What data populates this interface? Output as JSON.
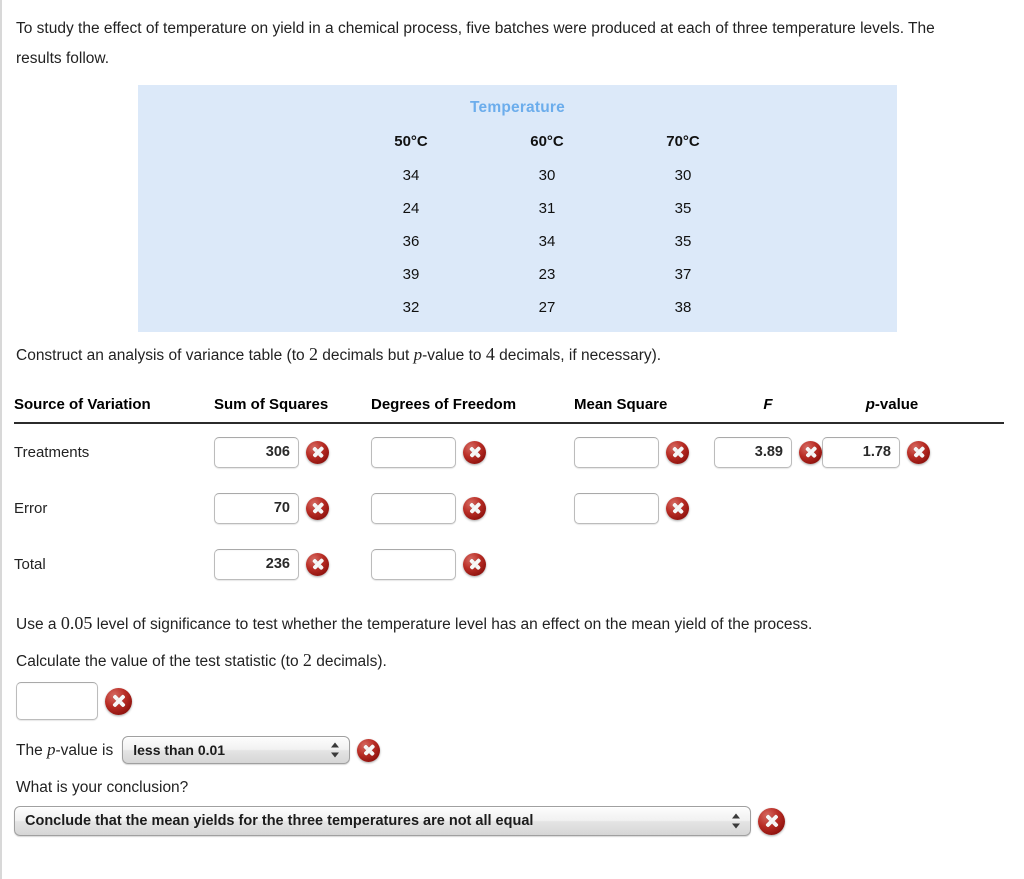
{
  "intro": {
    "text": "To study the effect of temperature on yield in a chemical process, five batches were produced at each of three temperature levels. The results follow."
  },
  "data_table": {
    "title": "Temperature",
    "columns": [
      "50°C",
      "60°C",
      "70°C"
    ],
    "rows": [
      [
        "34",
        "30",
        "30"
      ],
      [
        "24",
        "31",
        "35"
      ],
      [
        "36",
        "34",
        "35"
      ],
      [
        "39",
        "23",
        "37"
      ],
      [
        "32",
        "27",
        "38"
      ]
    ],
    "background_color": "#dce9f9",
    "title_color": "#6cadec"
  },
  "construct_line": {
    "part1": "Construct an analysis of variance table (to ",
    "decimals1": "2",
    "part2": " decimals but ",
    "pvar": "p",
    "part3": "-value to ",
    "decimals2": "4",
    "part4": " decimals, if necessary)."
  },
  "anova": {
    "headers": {
      "source": "Source of Variation",
      "ss": "Sum of Squares",
      "df": "Degrees of Freedom",
      "ms": "Mean Square",
      "f": "F",
      "p_italic": "p",
      "p_rest": "-value"
    },
    "rows": [
      {
        "label": "Treatments",
        "ss": "306",
        "ss_status": "error",
        "df": "",
        "df_status": "error",
        "ms": "",
        "ms_status": "error",
        "f": "3.89",
        "f_status": "error",
        "p": "1.78",
        "p_status": "error"
      },
      {
        "label": "Error",
        "ss": "70",
        "ss_status": "error",
        "df": "",
        "df_status": "error",
        "ms": "",
        "ms_status": "error",
        "f": null,
        "f_status": null,
        "p": null,
        "p_status": null
      },
      {
        "label": "Total",
        "ss": "236",
        "ss_status": "error",
        "df": "",
        "df_status": "error",
        "ms": null,
        "ms_status": null,
        "f": null,
        "f_status": null,
        "p": null,
        "p_status": null
      }
    ]
  },
  "significance": {
    "prefix": "Use a ",
    "level": "0.05",
    "suffix": " level of significance to test whether the temperature level has an effect on the mean yield of the process."
  },
  "test_statistic": {
    "prompt_prefix": "Calculate the value of the test statistic (to ",
    "decimals": "2",
    "prompt_suffix": " decimals).",
    "value": "",
    "status": "error"
  },
  "p_value": {
    "label_prefix": "The ",
    "label_italic": "p",
    "label_suffix": "-value is",
    "selected": "less than 0.01",
    "status": "error"
  },
  "conclusion": {
    "question": "What is your conclusion?",
    "selected": "Conclude that the mean yields for the three temperatures are not all equal",
    "status": "error"
  },
  "icons": {
    "error": "error-x-icon",
    "stepper": "stepper-arrows-icon"
  },
  "colors": {
    "error_red": "#b92d25",
    "table_bg": "#dce9f9",
    "table_title": "#6cadec",
    "text": "#222222"
  }
}
